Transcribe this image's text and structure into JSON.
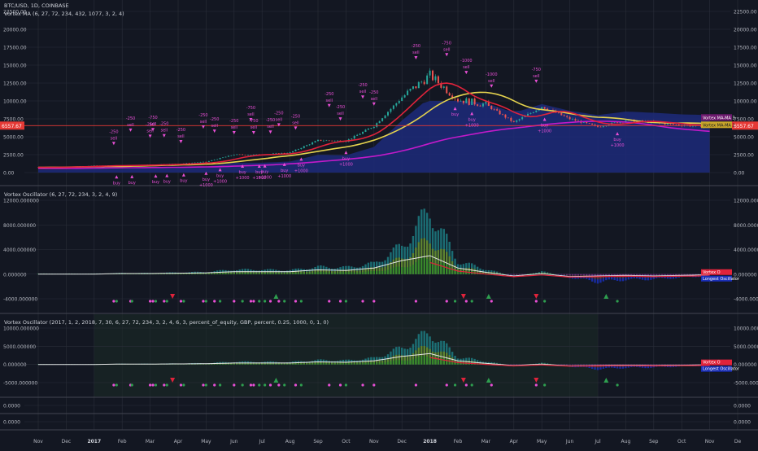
{
  "colors": {
    "background": "#131722",
    "grid": "#2a2e39",
    "separator": "#434651",
    "axis_text": "#b2b5be",
    "title_text": "#d1d4dc",
    "price_line": "#e53935",
    "ma_yellow": "#e5d34e",
    "ma_red": "#e0233b",
    "ma_purple": "#c21ac9",
    "ma_navy": "#1d2a7a",
    "candle_up": "#26a69a",
    "candle_down": "#ef5350",
    "signal_pink": "#e94fd6",
    "signal_green": "#2e9e4f",
    "osc_teal": "#1d7c82",
    "osc_olive": "#6f8a1f",
    "osc_purple": "#6c2a8a",
    "osc_blue": "#1a2fb8",
    "osc_brown": "#6b3a1a",
    "osc_red": "#e0233b",
    "osc_white": "#e6e6e6",
    "strategy_bg": "#1b2a26"
  },
  "panes": {
    "main": {
      "title": "BTC/USD, 1D, COINBASE",
      "indicator": "Vortex MA (6, 27, 72, 234, 432, 1077, 3, 2, 4)"
    },
    "osc1": {
      "title": "Vortex Oscillator (6, 27, 72, 234, 3, 2, 4, 9)"
    },
    "osc2": {
      "title": "Vortex Oscillator (2017, 1, 2, 2018, 7, 30, 6, 27, 72, 234, 3, 2, 4, 6, 3, percent_of_equity, GBP, percent, 0.25, 1000, 0, 1, 0)"
    }
  },
  "price_tag": "6557.67",
  "price_tag_left": "6557.67",
  "main_labels": [
    "Vortex MA-MA 3",
    "Vortex MA-MA 2"
  ],
  "osc1_labels": [
    "Vortex O",
    "Longest Oscillator"
  ],
  "osc2_labels": [
    "Vortex O",
    "Longest Oscillator"
  ],
  "chart_data": {
    "type": "line",
    "x_labels": [
      "Nov",
      "Dec",
      "2017",
      "Feb",
      "Mar",
      "Apr",
      "May",
      "Jun",
      "Jul",
      "Aug",
      "Sep",
      "Oct",
      "Nov",
      "Dec",
      "2018",
      "Feb",
      "Mar",
      "Apr",
      "May",
      "Jun",
      "Jul",
      "Aug",
      "Sep",
      "Oct",
      "Nov",
      "De"
    ],
    "main_y_ticks": [
      "22500.00",
      "20000.00",
      "17500.00",
      "15000.00",
      "12500.00",
      "10000.00",
      "7500.00",
      "5000.00",
      "2500.00",
      "0.00"
    ],
    "main_ylim": [
      0,
      22500
    ],
    "osc1_y_ticks": [
      "12000.000000",
      "8000.000000",
      "4000.000000",
      "0.000000",
      "-4000.000000"
    ],
    "osc1_ylim": [
      -4000,
      12000
    ],
    "osc2_y_ticks": [
      "10000.000000",
      "5000.000000",
      "0.000000",
      "-5000.000000"
    ],
    "osc2_ylim": [
      -5000,
      10000
    ],
    "small_panes_y_ticks": [
      "0.0000",
      "0.0000"
    ],
    "btc_close_months": [
      730,
      780,
      960,
      1000,
      1100,
      1230,
      1500,
      2500,
      2500,
      2800,
      4500,
      4400,
      6500,
      10500,
      13600,
      10200,
      9500,
      7000,
      9200,
      7500,
      6400,
      7300,
      7000,
      6600,
      6400
    ],
    "price_line_value": 6557.67,
    "trade_markers": [
      {
        "month": 2.7,
        "side": "sell",
        "amount": "-250"
      },
      {
        "month": 2.8,
        "side": "buy",
        "amount": ""
      },
      {
        "month": 3.3,
        "side": "sell",
        "amount": "-250"
      },
      {
        "month": 3.35,
        "side": "buy",
        "amount": ""
      },
      {
        "month": 4.0,
        "side": "sell",
        "amount": "-250"
      },
      {
        "month": 4.1,
        "side": "sell",
        "amount": "-750"
      },
      {
        "month": 4.2,
        "side": "buy",
        "amount": ""
      },
      {
        "month": 4.5,
        "side": "sell",
        "amount": "-250"
      },
      {
        "month": 4.6,
        "side": "buy",
        "amount": ""
      },
      {
        "month": 5.1,
        "side": "sell",
        "amount": "-250"
      },
      {
        "month": 5.2,
        "side": "buy",
        "amount": ""
      },
      {
        "month": 5.9,
        "side": "sell",
        "amount": "-250"
      },
      {
        "month": 6.0,
        "side": "buy",
        "amount": "+1000"
      },
      {
        "month": 6.3,
        "side": "sell",
        "amount": "-250"
      },
      {
        "month": 6.5,
        "side": "buy",
        "amount": "+1000"
      },
      {
        "month": 7.0,
        "side": "sell",
        "amount": "-250"
      },
      {
        "month": 7.3,
        "side": "buy",
        "amount": "+1000"
      },
      {
        "month": 7.6,
        "side": "sell",
        "amount": "-750"
      },
      {
        "month": 7.7,
        "side": "sell",
        "amount": "-750"
      },
      {
        "month": 7.9,
        "side": "buy",
        "amount": "+1000"
      },
      {
        "month": 8.1,
        "side": "buy",
        "amount": "+1000"
      },
      {
        "month": 8.3,
        "side": "sell",
        "amount": "-250"
      },
      {
        "month": 8.6,
        "side": "sell",
        "amount": "-250"
      },
      {
        "month": 8.8,
        "side": "buy",
        "amount": "+1000"
      },
      {
        "month": 9.2,
        "side": "sell",
        "amount": "-250"
      },
      {
        "month": 9.4,
        "side": "buy",
        "amount": "+1000"
      },
      {
        "month": 10.4,
        "side": "sell",
        "amount": "-250"
      },
      {
        "month": 10.8,
        "side": "sell",
        "amount": "-250"
      },
      {
        "month": 11.0,
        "side": "buy",
        "amount": "+1000"
      },
      {
        "month": 11.6,
        "side": "sell",
        "amount": "-250"
      },
      {
        "month": 12.0,
        "side": "sell",
        "amount": "-250"
      },
      {
        "month": 13.5,
        "side": "sell",
        "amount": "-250"
      },
      {
        "month": 14.6,
        "side": "sell",
        "amount": "-750"
      },
      {
        "month": 14.9,
        "side": "buy",
        "amount": ""
      },
      {
        "month": 15.3,
        "side": "sell",
        "amount": "-1000"
      },
      {
        "month": 15.5,
        "side": "buy",
        "amount": "+1000"
      },
      {
        "month": 16.2,
        "side": "sell",
        "amount": "-1000"
      },
      {
        "month": 17.8,
        "side": "sell",
        "amount": "-750"
      },
      {
        "month": 18.1,
        "side": "buy",
        "amount": "+1000"
      },
      {
        "month": 20.7,
        "side": "buy",
        "amount": "+1000"
      }
    ],
    "osc1_histogram_months": [
      0.1,
      0.1,
      0.1,
      0.2,
      0.2,
      0.3,
      0.4,
      0.8,
      0.8,
      0.7,
      1.3,
      1.2,
      1.9,
      5.0,
      11.5,
      2.3,
      0.9,
      -0.4,
      0.5,
      -0.6,
      -1.4,
      -1.0,
      -0.9,
      -0.6,
      -0.3
    ],
    "osc1_white_months": [
      0.0,
      0.0,
      0.0,
      0.1,
      0.1,
      0.15,
      0.2,
      0.4,
      0.4,
      0.4,
      0.7,
      0.6,
      1.0,
      2.2,
      3.0,
      1.0,
      0.3,
      -0.3,
      0.1,
      -0.4,
      -0.3,
      -0.2,
      -0.3,
      -0.2,
      -0.1
    ],
    "osc2_histogram_months": [
      0.1,
      0.1,
      0.1,
      0.2,
      0.2,
      0.3,
      0.4,
      0.8,
      0.8,
      0.7,
      1.3,
      1.2,
      1.9,
      5.0,
      9.8,
      2.3,
      0.9,
      -0.4,
      0.5,
      -0.6,
      -1.4,
      -1.0,
      -0.9,
      -0.6,
      -0.3
    ],
    "osc2_white_months": [
      0.0,
      0.0,
      0.0,
      0.1,
      0.1,
      0.15,
      0.2,
      0.4,
      0.4,
      0.4,
      0.7,
      0.6,
      1.0,
      2.2,
      3.0,
      1.0,
      0.3,
      -0.3,
      0.1,
      -0.4,
      -0.3,
      -0.2,
      -0.3,
      -0.2,
      -0.1
    ],
    "strategy_range_months": [
      2.0,
      20.0
    ]
  }
}
